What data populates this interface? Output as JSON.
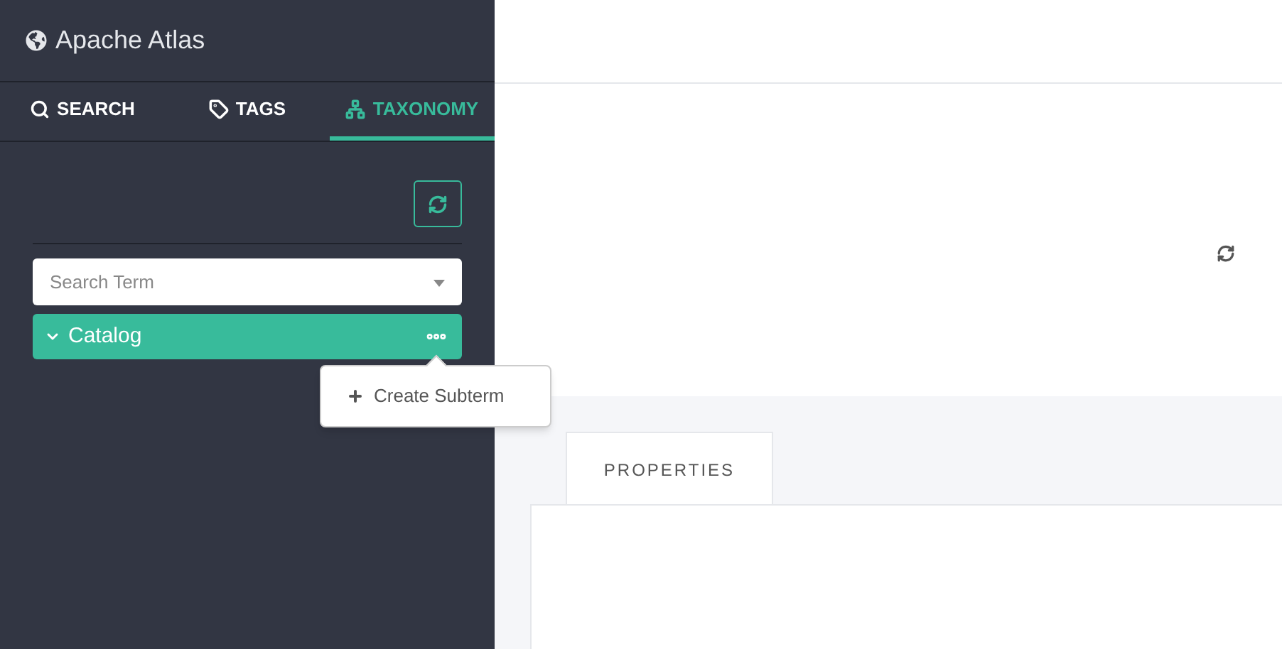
{
  "app": {
    "title": "Apache Atlas"
  },
  "tabs": [
    {
      "label": "SEARCH",
      "selected": false,
      "kind": "search"
    },
    {
      "label": "TAGS",
      "selected": false,
      "kind": "tags"
    },
    {
      "label": "TAXONOMY",
      "selected": true,
      "kind": "taxonomy"
    }
  ],
  "search": {
    "placeholder": "Search Term"
  },
  "tree": [
    {
      "label": "Catalog",
      "expanded": true,
      "selected": true
    }
  ],
  "menu": {
    "items": [
      {
        "label": "Create Subterm"
      }
    ]
  },
  "detail_tabs": [
    {
      "label": "PROPERTIES",
      "selected": true
    }
  ]
}
